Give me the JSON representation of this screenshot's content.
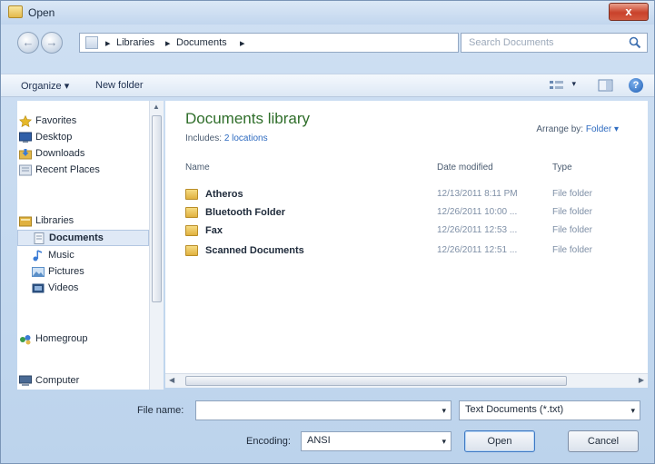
{
  "window": {
    "title": "Open",
    "close_glyph": "x"
  },
  "nav": {
    "back_glyph": "←",
    "forward_glyph": "→",
    "breadcrumbs": [
      "Libraries",
      "Documents"
    ],
    "separator": "▸",
    "dropdown_glyph": "▾",
    "refresh_glyph": "↻",
    "search_placeholder": "Search Documents"
  },
  "toolbar": {
    "organize_label": "Organize ▾",
    "new_folder_label": "New folder",
    "help_glyph": "?"
  },
  "navpane": {
    "items": [
      {
        "label": "Favorites",
        "icon": "star-icon",
        "color": "#e6b829"
      },
      {
        "label": "Desktop",
        "icon": "desktop-icon",
        "color": "#2f5fa8"
      },
      {
        "label": "Downloads",
        "icon": "downloads-icon",
        "color": "#3a7bd5"
      },
      {
        "label": "Recent Places",
        "icon": "recent-places-icon",
        "color": "#8a9ab0"
      },
      {
        "label": "Libraries",
        "icon": "libraries-icon",
        "color": "#e0b13f"
      },
      {
        "label": "Documents",
        "icon": "documents-icon",
        "color": "#c9d6e8"
      },
      {
        "label": "Music",
        "icon": "music-icon",
        "color": "#3a7bd5"
      },
      {
        "label": "Pictures",
        "icon": "pictures-icon",
        "color": "#5a8fc8"
      },
      {
        "label": "Videos",
        "icon": "videos-icon",
        "color": "#2b4f7e"
      },
      {
        "label": "Homegroup",
        "icon": "homegroup-icon",
        "color": "#3a9c4a"
      },
      {
        "label": "Computer",
        "icon": "computer-icon",
        "color": "#4a6a94"
      }
    ]
  },
  "library": {
    "title": "Documents library",
    "includes_prefix": "Includes:",
    "includes_link": "2 locations",
    "arrange_prefix": "Arrange by:",
    "arrange_value": "Folder ▾"
  },
  "columns": {
    "name": "Name",
    "date": "Date modified",
    "type": "Type"
  },
  "files": [
    {
      "name": "Atheros",
      "date": "12/13/2011 8:11 PM",
      "type": "File folder"
    },
    {
      "name": "Bluetooth Folder",
      "date": "12/26/2011 10:00 ...",
      "type": "File folder"
    },
    {
      "name": "Fax",
      "date": "12/26/2011 12:53 ...",
      "type": "File folder"
    },
    {
      "name": "Scanned Documents",
      "date": "12/26/2011 12:51 ...",
      "type": "File folder"
    }
  ],
  "bottom": {
    "file_name_label": "File name:",
    "file_name_value": "",
    "filter_value": "Text Documents (*.txt)",
    "encoding_label": "Encoding:",
    "encoding_value": "ANSI",
    "open_label": "Open",
    "cancel_label": "Cancel",
    "drop_glyph": "▾"
  }
}
